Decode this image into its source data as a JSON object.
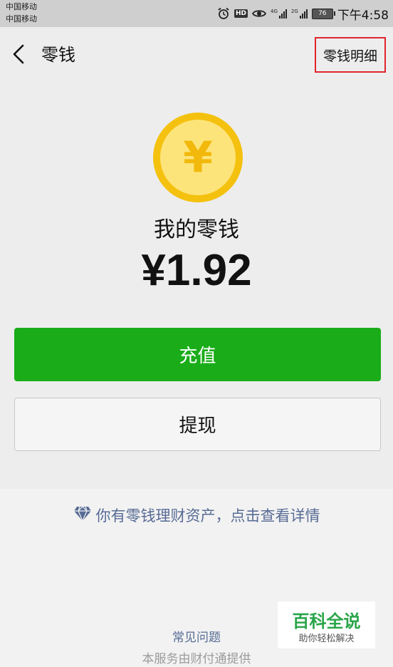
{
  "status_bar": {
    "carrier_1": "中国移动",
    "carrier_2": "中国移动",
    "alarm_icon": "alarm-clock-icon",
    "hd_badge": "HD",
    "eye_icon": "eye-comfort-icon",
    "net_1": "4G",
    "net_2": "2G",
    "battery": "76",
    "time": "下午4:58"
  },
  "nav": {
    "back_icon": "chevron-left-icon",
    "title": "零钱",
    "detail_link": "零钱明细",
    "detail_highlight_color": "#e0242d"
  },
  "wallet": {
    "coin_icon": "yuan-coin-icon",
    "coin_symbol": "¥",
    "label": "我的零钱",
    "amount": "¥1.92"
  },
  "actions": {
    "recharge": "充值",
    "recharge_color": "#1aad19",
    "withdraw": "提现"
  },
  "wealth": {
    "icon": "diamond-icon",
    "link_text": "你有零钱理财资产，点击查看详情",
    "link_color": "#576b95"
  },
  "footer": {
    "faq": "常见问题",
    "provider": "本服务由财付通提供"
  },
  "watermark": {
    "title": "百科全说",
    "subtitle": "助你轻松解决"
  }
}
